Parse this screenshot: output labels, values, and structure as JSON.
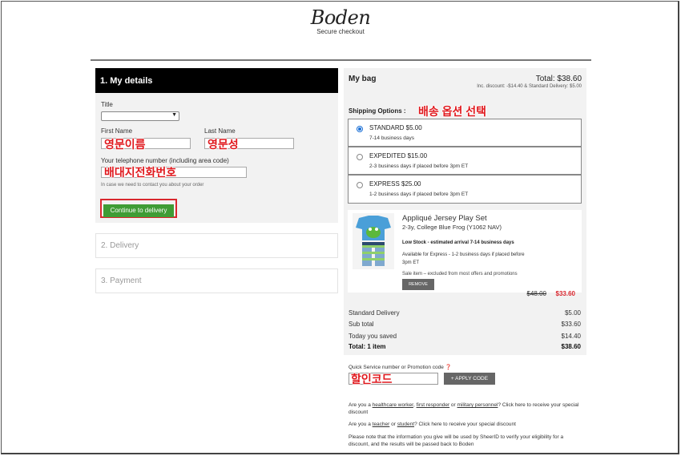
{
  "header": {
    "logo": "Boden",
    "subtitle": "Secure checkout"
  },
  "details": {
    "heading": "1. My details",
    "title_label": "Title",
    "title_value": "",
    "first_name_label": "First Name",
    "last_name_label": "Last Name",
    "phone_label": "Your telephone number (including area code)",
    "phone_hint": "In case we need to contact you about your order",
    "continue_label": "Continue to delivery",
    "annotations": {
      "first_name": "영문이름",
      "last_name": "영문성",
      "phone": "배대지전화번호",
      "shipping": "배송 옵션 선택",
      "promo": "할인코드"
    }
  },
  "steps": {
    "delivery": "2. Delivery",
    "payment": "3. Payment"
  },
  "bag": {
    "title": "My bag",
    "total": "Total: $38.60",
    "total_sub": "Inc. discount: -$14.40 & Standard Delivery: $5.00",
    "shipping_label": "Shipping Options :",
    "options": [
      {
        "name": "STANDARD $5.00",
        "desc": "7-14 business days",
        "selected": true
      },
      {
        "name": "EXPEDITED $15.00",
        "desc": "2-3 business days if placed before 3pm ET",
        "selected": false
      },
      {
        "name": "EXPRESS $25.00",
        "desc": "1-2 business days if placed before 3pm ET",
        "selected": false
      }
    ],
    "item": {
      "name": "Appliqué Jersey Play Set",
      "variant": "2-3y, College Blue Frog (Y1062 NAV)",
      "stock": "Low Stock - estimated arrival 7-14 business days",
      "express_note": "Available for Express - 1-2 business days if placed before 3pm ET",
      "sale_note": "Sale item – excluded from most offers and promotions",
      "remove_label": "REMOVE",
      "old_price": "$48.00",
      "new_price": "$33.60"
    },
    "summary": [
      {
        "label": "Standard Delivery",
        "value": "$5.00",
        "bold": false
      },
      {
        "label": "Sub total",
        "value": "$33.60",
        "bold": false
      },
      {
        "label": "Today you saved",
        "value": "$14.40",
        "bold": false
      },
      {
        "label": "Total: 1 item",
        "value": "$38.60",
        "bold": true
      }
    ]
  },
  "promo": {
    "label": "Quick Service number or Promotion code",
    "apply_label": "+ APPLY CODE"
  },
  "notes": {
    "n1_a": "Are you a ",
    "n1_link1": "healthcare worker",
    "n1_sep1": ", ",
    "n1_link2": "first responder",
    "n1_sep2": " or ",
    "n1_link3": "military personnel",
    "n1_b": "? Click here to receive your special discount",
    "n2_a": "Are you a ",
    "n2_link1": "teacher",
    "n2_sep": " or ",
    "n2_link2": "student",
    "n2_b": "? Click here to receive your special discount",
    "n3": "Please note that the information you give will be used by SheerID to verify your eligibility for a discount, and the results will be passed back to Boden"
  },
  "colors": {
    "accent_red": "#d9272e",
    "continue_green": "#3f9c35",
    "radio_blue": "#1a6fd6"
  }
}
